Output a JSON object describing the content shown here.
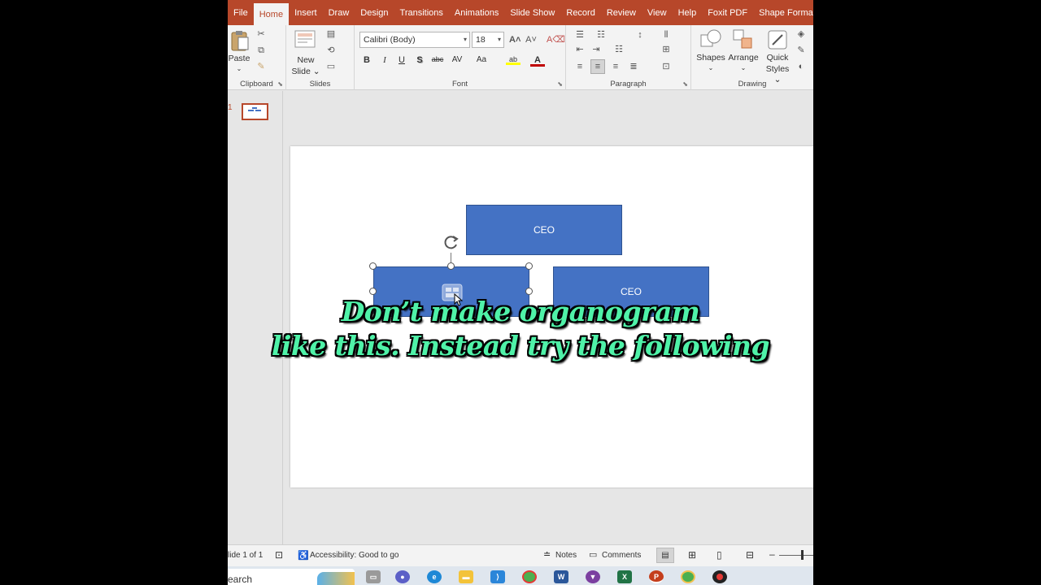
{
  "menu": {
    "tabs": [
      {
        "label": "File"
      },
      {
        "label": "Home"
      },
      {
        "label": "Insert"
      },
      {
        "label": "Draw"
      },
      {
        "label": "Design"
      },
      {
        "label": "Transitions"
      },
      {
        "label": "Animations"
      },
      {
        "label": "Slide Show"
      },
      {
        "label": "Record"
      },
      {
        "label": "Review"
      },
      {
        "label": "View"
      },
      {
        "label": "Help"
      },
      {
        "label": "Foxit PDF"
      },
      {
        "label": "Shape Format"
      }
    ],
    "active_tab": "Home"
  },
  "ribbon": {
    "clipboard": {
      "paste_label": "Paste",
      "group_label": "Clipboard"
    },
    "slides": {
      "new_slide_label_1": "New",
      "new_slide_label_2": "Slide",
      "group_label": "Slides"
    },
    "font": {
      "font_name": "Calibri (Body)",
      "font_size": "18",
      "group_label": "Font",
      "bold": "B",
      "italic": "I",
      "underline": "U",
      "shadow": "S",
      "strike": "abc",
      "spacing": "AV",
      "case": "Aa",
      "color": "A"
    },
    "paragraph": {
      "group_label": "Paragraph"
    },
    "drawing": {
      "shapes_label": "Shapes",
      "arrange_label": "Arrange",
      "quick_styles_label_1": "Quick",
      "quick_styles_label_2": "Styles",
      "group_label": "Drawing"
    }
  },
  "thumbnail": {
    "number": "1"
  },
  "slide": {
    "boxes": [
      {
        "label": "CEO"
      },
      {
        "label": ""
      },
      {
        "label": "CEO"
      }
    ]
  },
  "caption": {
    "line1": "Don’t make organogram",
    "line2": "like this. Instead try the following"
  },
  "status": {
    "slide_info": "lide 1 of 1",
    "accessibility": "Accessibility: Good to go",
    "notes": "Notes",
    "comments": "Comments"
  },
  "taskbar": {
    "search_placeholder": "earch"
  },
  "colors": {
    "accent": "#b7472a",
    "shape_fill": "#4472c4",
    "caption_fill": "#4ff2a8"
  }
}
